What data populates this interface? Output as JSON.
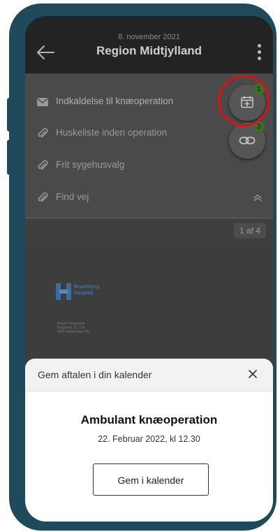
{
  "header": {
    "date": "8. november 2021",
    "title": "Region Midtjylland"
  },
  "menu": {
    "items": [
      {
        "label": "Indkaldelse til knæoperation",
        "icon": "envelope-icon"
      },
      {
        "label": "Huskeliste inden operation",
        "icon": "paperclip-icon"
      },
      {
        "label": "Frit sygehusvalg",
        "icon": "paperclip-icon"
      },
      {
        "label": "Find vej",
        "icon": "paperclip-icon"
      }
    ]
  },
  "pager": {
    "label": "1 af 4"
  },
  "fabs": {
    "calendar_badge": "1",
    "link_badge": "3"
  },
  "document": {
    "logo_line1": "Bispebjerg",
    "logo_line2": "Hospital",
    "address": [
      "Borger Borgersen",
      "Borgervej 16, 3 th",
      "2400 København NV"
    ]
  },
  "sheet": {
    "title": "Gem aftalen i din kalender",
    "event_title": "Ambulant knæoperation",
    "event_time": "22. Februar 2022, kl 12.30",
    "save_label": "Gem i kalender"
  },
  "colors": {
    "phone_frame": "#1f4a5c",
    "highlight_ring": "#dd1111",
    "badge": "#3d6d2c"
  }
}
